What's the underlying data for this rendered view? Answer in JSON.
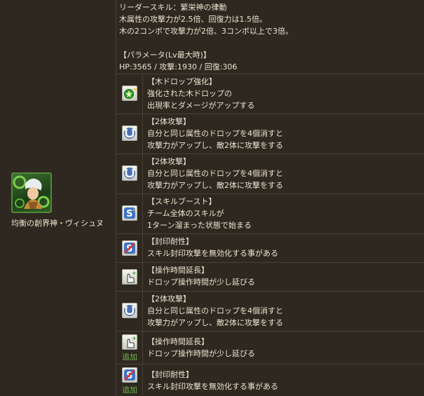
{
  "character": {
    "name": "均衡の創界神・ヴィシュヌ"
  },
  "leader_skill": {
    "lines": [
      "リーダースキル：繁栄神の律動",
      "木属性の攻撃力が2.5倍、回復力は1.5倍。",
      "木の2コンボで攻撃力が2倍、3コンボ以上で3倍。",
      "",
      "【パラメータ(Lv最大時)】",
      "HP:3565 / 攻撃:1930 / 回復:306"
    ]
  },
  "awakenings": [
    {
      "icon": "wood-orb-enhance-icon",
      "lines": [
        "【木ドロップ強化】",
        "強化された木ドロップの",
        "出現率とダメージがアップする"
      ]
    },
    {
      "icon": "two-prong-attack-icon",
      "lines": [
        "【2体攻撃】",
        "自分と同じ属性のドロップを4個消すと",
        "攻撃力がアップし、敵2体に攻撃をする"
      ]
    },
    {
      "icon": "two-prong-attack-icon",
      "lines": [
        "【2体攻撃】",
        "自分と同じ属性のドロップを4個消すと",
        "攻撃力がアップし、敵2体に攻撃をする"
      ]
    },
    {
      "icon": "skill-boost-icon",
      "lines": [
        "【スキルブースト】",
        "チーム全体のスキルが",
        "1ターン溜まった状態で始まる"
      ]
    },
    {
      "icon": "skill-bind-resist-icon",
      "lines": [
        "【封印耐性】",
        "スキル封印攻撃を無効化する事がある"
      ]
    },
    {
      "icon": "time-extend-icon",
      "lines": [
        "【操作時間延長】",
        "ドロップ操作時間が少し延びる"
      ]
    },
    {
      "icon": "two-prong-attack-icon",
      "lines": [
        "【2体攻撃】",
        "自分と同じ属性のドロップを4個消すと",
        "攻撃力がアップし、敵2体に攻撃をする"
      ]
    },
    {
      "icon": "time-extend-icon",
      "added": "追加",
      "lines": [
        "【操作時間延長】",
        "ドロップ操作時間が少し延びる"
      ]
    },
    {
      "icon": "skill-bind-resist-icon",
      "added": "追加",
      "lines": [
        "【封印耐性】",
        "スキル封印攻撃を無効化する事がある"
      ]
    }
  ]
}
